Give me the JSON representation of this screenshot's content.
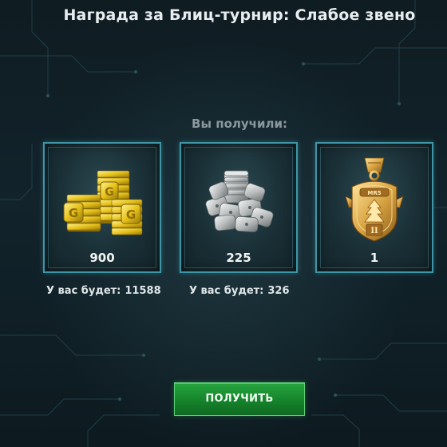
{
  "header": {
    "title": "Награда за Блиц-турнир: Слабое звено"
  },
  "rewards": {
    "heading": "Вы получили:",
    "items": [
      {
        "icon": "gold-bars-icon",
        "amount": "900",
        "will_have_label": "У вас будет:",
        "will_have_value": "11588"
      },
      {
        "icon": "silver-coins-icon",
        "amount": "225",
        "will_have_label": "У вас будет:",
        "will_have_value": "326"
      },
      {
        "icon": "medal-icon",
        "amount": "1"
      }
    ]
  },
  "actions": {
    "claim_label": "ПОЛУЧИТЬ"
  },
  "colors": {
    "card_border": "#3e95a6",
    "button_green": "#1c9434",
    "gold": "#e6c21c",
    "silver": "#b9bcbc"
  }
}
